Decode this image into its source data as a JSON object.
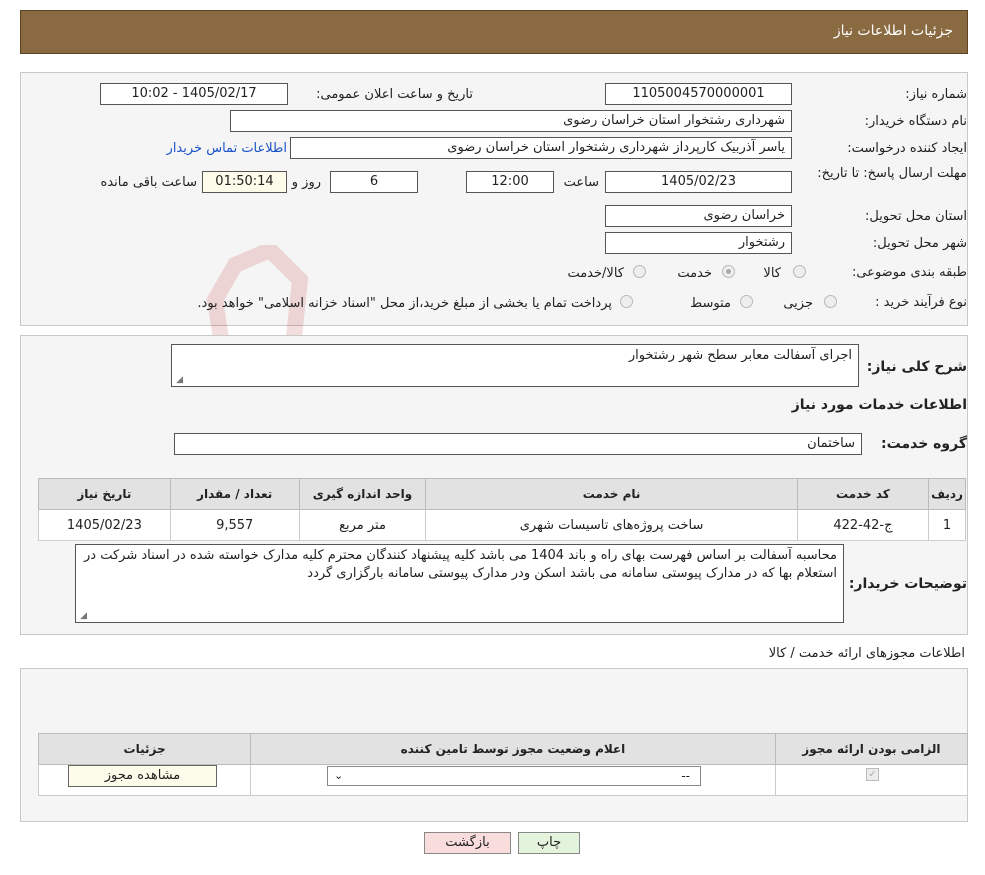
{
  "header": {
    "title": "جزئیات اطلاعات نیاز"
  },
  "form": {
    "need_number_label": "شماره نیاز:",
    "need_number": "1105004570000001",
    "announce_label": "تاریخ و ساعت اعلان عمومی:",
    "announce_value": "1405/02/17 - 10:02",
    "buyer_org_label": "نام دستگاه خریدار:",
    "buyer_org": "شهرداری رشتخوار استان خراسان رضوی",
    "creator_label": "ایجاد کننده درخواست:",
    "creator": "یاسر آذربیک کارپرداز  شهرداری رشتخوار استان خراسان رضوی",
    "contact_link": "اطلاعات تماس خریدار",
    "deadline_label": "مهلت ارسال پاسخ: تا تاریخ:",
    "deadline_date": "1405/02/23",
    "time_label": "ساعت",
    "deadline_time": "12:00",
    "days": "6",
    "days_label": "روز و",
    "remaining": "01:50:14",
    "remaining_label": "ساعت باقی مانده",
    "province_label": "استان محل تحویل:",
    "province": "خراسان رضوی",
    "city_label": "شهر محل تحویل:",
    "city": "رشتخوار",
    "category_label": "طبقه بندی موضوعی:",
    "category_options": [
      "کالا",
      "خدمت",
      "کالا/خدمت"
    ],
    "category_selected": "خدمت",
    "process_label": "نوع فرآیند خرید :",
    "process_options": [
      "جزیی",
      "متوسط"
    ],
    "process_note": "پرداخت تمام یا بخشی از مبلغ خرید،از محل \"اسناد خزانه اسلامی\" خواهد بود."
  },
  "details": {
    "summary_label": "شرح کلی نیاز:",
    "summary": "اجرای آسفالت معابر سطح شهر رشتخوار",
    "services_title": "اطلاعات خدمات مورد نیاز",
    "group_label": "گروه خدمت:",
    "group_value": "ساختمان",
    "table_headers": [
      "ردیف",
      "کد خدمت",
      "نام خدمت",
      "واحد اندازه گیری",
      "تعداد / مقدار",
      "تاریخ نیاز"
    ],
    "rows": [
      {
        "idx": "1",
        "code": "ج-42-422",
        "name": "ساخت پروژه‌های تاسیسات شهری",
        "unit": "متر مربع",
        "qty": "9,557",
        "date": "1405/02/23"
      }
    ],
    "buyer_notes_label": "توضیحات خریدار:",
    "buyer_notes": "محاسبه آسفالت بر اساس فهرست بهای راه و باند 1404 می باشد کلیه پیشنهاد کنندگان محترم کلیه مدارک خواسته شده در اسناد شرکت در استعلام بها که در مدارک پیوستی سامانه می باشد اسکن ودر مدارک پیوستی سامانه بارگزاری گردد"
  },
  "permits": {
    "title": "اطلاعات مجوزهای ارائه خدمت / کالا",
    "headers": [
      "الزامی بودن ارائه مجوز",
      "اعلام وضعیت مجوز توسط تامین کننده",
      "جزئیات"
    ],
    "select_value": "--",
    "view_button": "مشاهده مجوز"
  },
  "buttons": {
    "back": "بازگشت",
    "print": "چاپ"
  },
  "colors": {
    "header_bg": "#8a6a41",
    "back_btn": "#f9dcdc",
    "print_btn": "#e4f3dc"
  }
}
